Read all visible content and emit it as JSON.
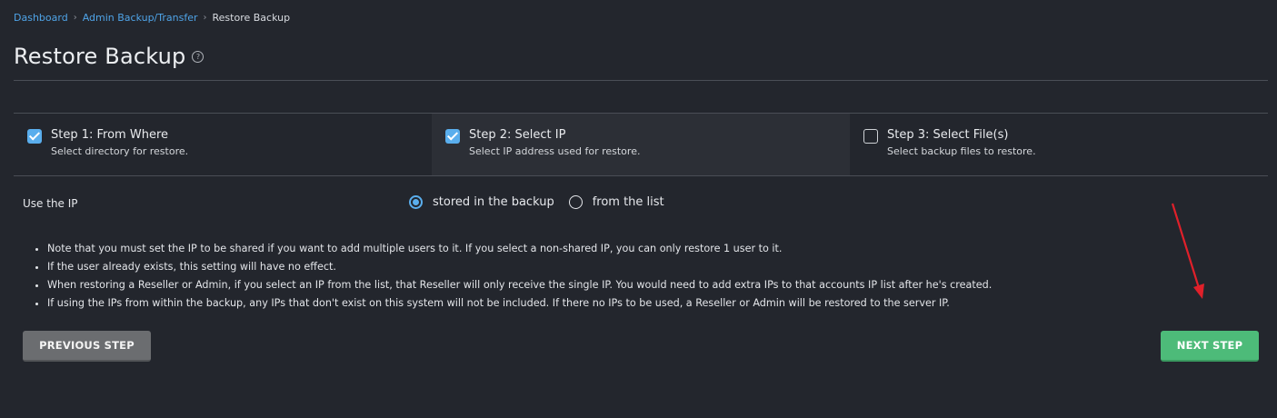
{
  "breadcrumb": {
    "items": [
      "Dashboard",
      "Admin Backup/Transfer"
    ],
    "separator": "›",
    "current": "Restore Backup"
  },
  "page": {
    "title": "Restore Backup",
    "help_icon": "question-circle-icon"
  },
  "steps": [
    {
      "title": "Step 1: From Where",
      "desc": "Select directory for restore.",
      "checked": true
    },
    {
      "title": "Step 2: Select IP",
      "desc": "Select IP address used for restore.",
      "checked": true,
      "active": true
    },
    {
      "title": "Step 3: Select File(s)",
      "desc": "Select backup files to restore.",
      "checked": false
    }
  ],
  "ip_option": {
    "label": "Use the IP",
    "options": [
      "stored in the backup",
      "from the list"
    ],
    "selected": "stored in the backup"
  },
  "notes": [
    "Note that you must set the IP to be shared if you want to add multiple users to it. If you select a non-shared IP, you can only restore 1 user to it.",
    "If the user already exists, this setting will have no effect.",
    "When restoring a Reseller or Admin, if you select an IP from the list, that Reseller will only receive the single IP. You would need to add extra IPs to that accounts IP list after he's created.",
    "If using the IPs from within the backup, any IPs that don't exist on this system will not be included. If there no IPs to be used, a Reseller or Admin will be restored to the server IP."
  ],
  "buttons": {
    "previous": "PREVIOUS STEP",
    "next": "NEXT STEP"
  },
  "colors": {
    "background": "#23262d",
    "accent": "#5aaeed",
    "link": "#4fa4e8",
    "next_button": "#4dbb79",
    "prev_button": "#6b6d70",
    "annotation_arrow": "#e0202a"
  }
}
